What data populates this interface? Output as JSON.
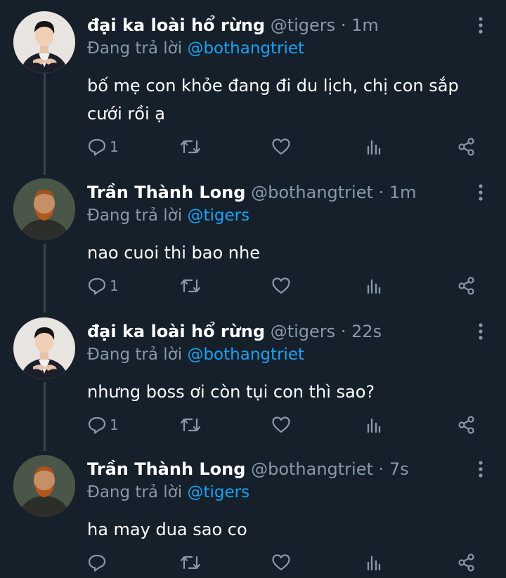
{
  "colors": {
    "background": "#15202b",
    "text_primary": "#ffffff",
    "text_secondary": "#8899a6",
    "link": "#1da1f2",
    "thread_line": "#38444d"
  },
  "tweets": [
    {
      "name": "đại ka loài hổ rừng",
      "handle": "@tigers",
      "separator": "·",
      "time": "1m",
      "replying_prefix": "Đang trả lời",
      "replying_to": "@bothangtriet",
      "text": "bố mẹ con khỏe đang đi du lịch, chị con sắp cưới rồi ạ",
      "reply_count": "1",
      "avatar": "young-man-avatar"
    },
    {
      "name": "Trần Thành Long",
      "handle": "@bothangtriet",
      "separator": "·",
      "time": "1m",
      "replying_prefix": "Đang trả lời",
      "replying_to": "@tigers",
      "text": "nao cuoi thi bao nhe",
      "reply_count": "1",
      "avatar": "van-gogh-portrait-avatar"
    },
    {
      "name": "đại ka loài hổ rừng",
      "handle": "@tigers",
      "separator": "·",
      "time": "22s",
      "replying_prefix": "Đang trả lời",
      "replying_to": "@bothangtriet",
      "text": "nhưng boss ơi còn tụi con thì sao?",
      "reply_count": "1",
      "avatar": "young-man-avatar"
    },
    {
      "name": "Trần Thành Long",
      "handle": "@bothangtriet",
      "separator": "·",
      "time": "7s",
      "replying_prefix": "Đang trả lời",
      "replying_to": "@tigers",
      "text": "ha may dua sao co",
      "reply_count": "",
      "avatar": "van-gogh-portrait-avatar"
    }
  ],
  "icons": {
    "reply": "reply-icon",
    "retweet": "retweet-icon",
    "like": "heart-icon",
    "analytics": "analytics-icon",
    "share": "share-icon",
    "more": "more-vertical-icon"
  }
}
